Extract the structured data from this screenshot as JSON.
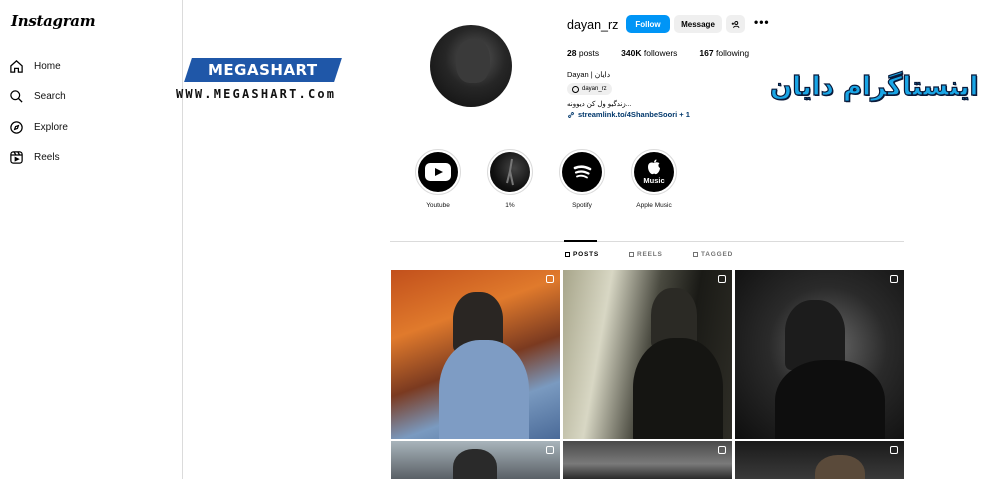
{
  "sidebar": {
    "logo": "Instagram",
    "items": [
      {
        "label": "Home",
        "icon": "home-icon"
      },
      {
        "label": "Search",
        "icon": "search-icon"
      },
      {
        "label": "Explore",
        "icon": "compass-icon"
      },
      {
        "label": "Reels",
        "icon": "reels-icon"
      }
    ]
  },
  "watermark": {
    "brand": "MEGASHART",
    "url": "WWW.MEGASHART.Com",
    "persian_title": "اینستاگرام دایان",
    "accent_color": "#1f57a8"
  },
  "profile": {
    "username": "dayan_rz",
    "follow_label": "Follow",
    "message_label": "Message",
    "add_user_label": "+",
    "more_label": "•••",
    "posts_count": "28",
    "posts_label": "posts",
    "followers_count": "340K",
    "followers_label": "followers",
    "following_count": "167",
    "following_label": "following",
    "full_name": "Dayan | دایان",
    "threads_handle": "dayan_rz",
    "bio": "زندگیو ول کن دیوونه...",
    "link": "streamlink.to/4ShanbeSoori + 1",
    "follow_color": "#0095f6"
  },
  "highlights": [
    {
      "label": "Youtube",
      "icon": "youtube-icon"
    },
    {
      "label": "1%",
      "icon": "figure-icon"
    },
    {
      "label": "Spotify",
      "icon": "spotify-icon"
    },
    {
      "label": "Apple Music",
      "icon": "apple-music-icon",
      "text": "Music"
    }
  ],
  "tabs": [
    {
      "label": "POSTS",
      "active": true
    },
    {
      "label": "REELS",
      "active": false
    },
    {
      "label": "TAGGED",
      "active": false
    }
  ],
  "posts": [
    {
      "type": "carousel"
    },
    {
      "type": "reel"
    },
    {
      "type": "reel"
    },
    {
      "type": "reel"
    },
    {
      "type": "reel"
    },
    {
      "type": "reel"
    }
  ]
}
